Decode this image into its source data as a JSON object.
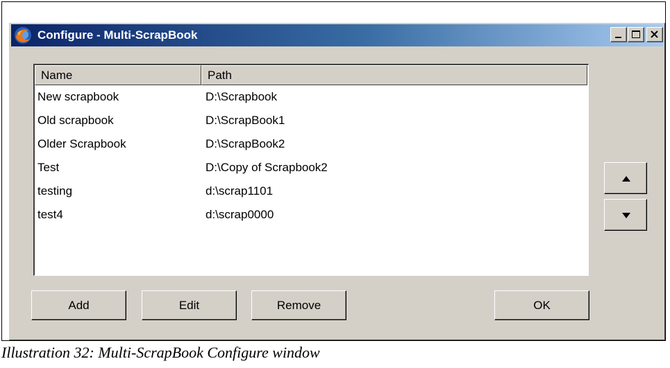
{
  "window": {
    "title": "Configure - Multi-ScrapBook",
    "icon": "firefox-icon",
    "controls": [
      "minimize-icon",
      "maximize-icon",
      "close-icon"
    ]
  },
  "list": {
    "columns": [
      "Name",
      "Path"
    ],
    "rows": [
      {
        "name": "New scrapbook",
        "path": "D:\\Scrapbook"
      },
      {
        "name": "Old scrapbook",
        "path": "D:\\ScrapBook1"
      },
      {
        "name": "Older Scrapbook",
        "path": "D:\\ScrapBook2"
      },
      {
        "name": "Test",
        "path": "D:\\Copy of Scrapbook2"
      },
      {
        "name": "testing",
        "path": "d:\\scrap1101"
      },
      {
        "name": "test4",
        "path": "d:\\scrap0000"
      }
    ]
  },
  "buttons": {
    "add": "Add",
    "edit": "Edit",
    "remove": "Remove",
    "ok": "OK",
    "move_up_icon": "arrow-up-icon",
    "move_down_icon": "arrow-down-icon"
  },
  "caption": "Illustration 32: Multi-ScrapBook Configure window",
  "colors": {
    "titlebar_start": "#0a246a",
    "titlebar_end": "#a6caf0",
    "dialog_face": "#d4d0c8"
  }
}
